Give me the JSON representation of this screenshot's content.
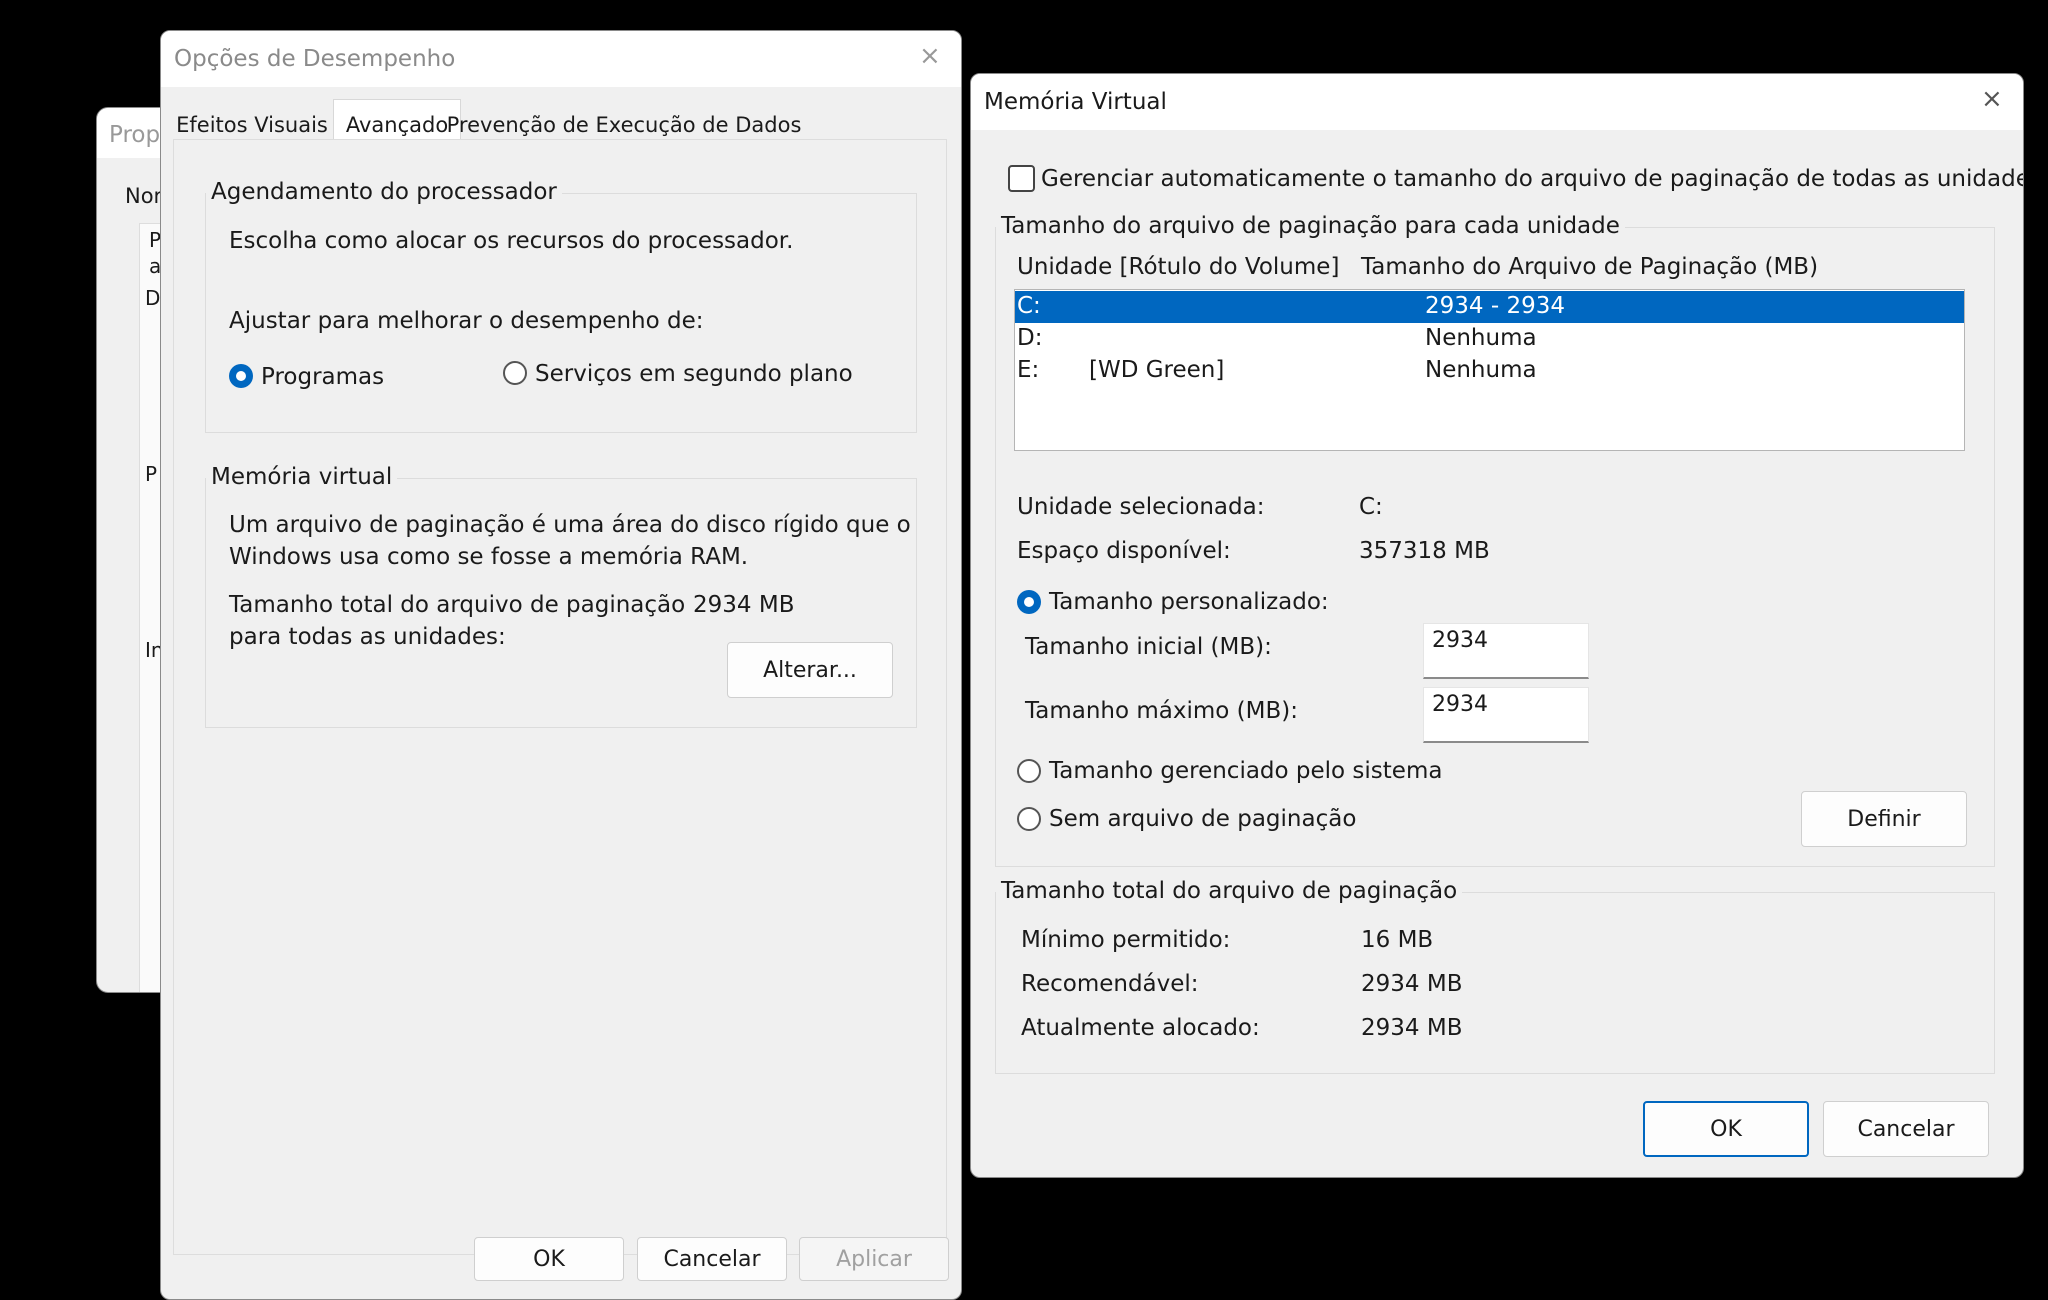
{
  "bg_window": {
    "title": "Prop",
    "tab": "Nor",
    "fragments": [
      "P",
      "a",
      "D",
      "P",
      "In"
    ]
  },
  "performance": {
    "title": "Opções de Desempenho",
    "close_label": "×",
    "tabs": [
      {
        "label": "Efeitos Visuais",
        "active": false
      },
      {
        "label": "Avançado",
        "active": true
      },
      {
        "label": "Prevenção de Execução de Dados",
        "active": false
      }
    ],
    "scheduling": {
      "legend": "Agendamento do processador",
      "description": "Escolha como alocar os recursos do processador.",
      "adjust_label": "Ajustar para melhorar o desempenho de:",
      "option_programs": "Programas",
      "option_services": "Serviços em segundo plano",
      "selected": "programs"
    },
    "virtual_memory": {
      "legend": "Memória virtual",
      "description_line1": "Um arquivo de paginação é uma área do disco rígido que o",
      "description_line2": "Windows usa como se fosse a memória RAM.",
      "total_label_line1": "Tamanho total do arquivo de paginação",
      "total_label_line2": "para todas as unidades:",
      "total_value": "2934 MB",
      "change_button": "Alterar..."
    },
    "buttons": {
      "ok": "OK",
      "cancel": "Cancelar",
      "apply": "Aplicar"
    }
  },
  "virtual": {
    "title": "Memória Virtual",
    "close_label": "×",
    "auto_manage_label": "Gerenciar automaticamente o tamanho do arquivo de paginação de todas as unidades",
    "auto_manage_checked": false,
    "per_drive_legend": "Tamanho do arquivo de paginação para cada unidade",
    "col_drive": "Unidade [Rótulo do Volume]",
    "col_size": "Tamanho do Arquivo de Paginação (MB)",
    "drives": [
      {
        "drive": "C:",
        "label": "",
        "size": "2934 - 2934",
        "selected": true
      },
      {
        "drive": "D:",
        "label": "",
        "size": "Nenhuma",
        "selected": false
      },
      {
        "drive": "E:",
        "label": "[WD Green]",
        "size": "Nenhuma",
        "selected": false
      }
    ],
    "selected_drive_label": "Unidade selecionada:",
    "selected_drive_value": "C:",
    "free_space_label": "Espaço disponível:",
    "free_space_value": "357318 MB",
    "custom_size_label": "Tamanho personalizado:",
    "initial_size_label": "Tamanho inicial (MB):",
    "initial_size_value": "2934",
    "max_size_label": "Tamanho máximo (MB):",
    "max_size_value": "2934",
    "system_managed_label": "Tamanho gerenciado pelo sistema",
    "no_paging_label": "Sem arquivo de paginação",
    "set_button": "Definir",
    "total_legend": "Tamanho total do arquivo de paginação",
    "min_label": "Mínimo permitido:",
    "min_value": "16 MB",
    "recommended_label": "Recomendável:",
    "recommended_value": "2934 MB",
    "allocated_label": "Atualmente alocado:",
    "allocated_value": "2934 MB",
    "ok_button": "OK",
    "cancel_button": "Cancelar",
    "accent_color": "#0067c0"
  }
}
